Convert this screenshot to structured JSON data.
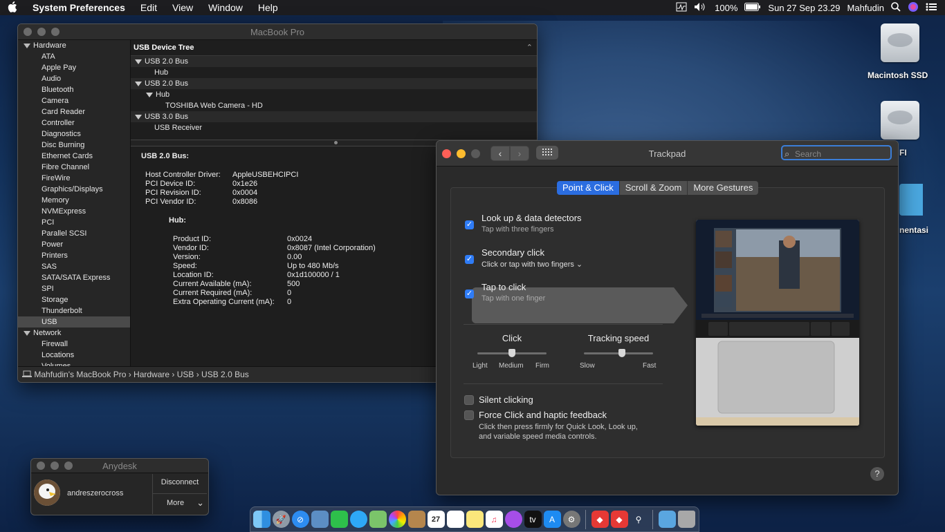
{
  "menubar": {
    "app_name": "System Preferences",
    "menus": [
      "Edit",
      "View",
      "Window",
      "Help"
    ],
    "battery": "100%",
    "datetime": "Sun 27 Sep  23.29",
    "user": "Mahfudin"
  },
  "desktop": {
    "icons": [
      "Macintosh SSD",
      "FI",
      "nentasi"
    ]
  },
  "sysinfo": {
    "title": "MacBook Pro",
    "sidebar": {
      "hardware_label": "Hardware",
      "hardware_items": [
        "ATA",
        "Apple Pay",
        "Audio",
        "Bluetooth",
        "Camera",
        "Card Reader",
        "Controller",
        "Diagnostics",
        "Disc Burning",
        "Ethernet Cards",
        "Fibre Channel",
        "FireWire",
        "Graphics/Displays",
        "Memory",
        "NVMExpress",
        "PCI",
        "Parallel SCSI",
        "Power",
        "Printers",
        "SAS",
        "SATA/SATA Express",
        "SPI",
        "Storage",
        "Thunderbolt",
        "USB"
      ],
      "selected": "USB",
      "network_label": "Network",
      "network_items": [
        "Firewall",
        "Locations",
        "Volumes"
      ]
    },
    "tree": {
      "header": "USB Device Tree",
      "rows": [
        {
          "label": "USB 2.0 Bus",
          "level": 0,
          "expanded": true
        },
        {
          "label": "Hub",
          "level": 1,
          "expanded": false
        },
        {
          "label": "USB 2.0 Bus",
          "level": 0,
          "expanded": true
        },
        {
          "label": "Hub",
          "level": 1,
          "expanded": true
        },
        {
          "label": "TOSHIBA Web Camera - HD",
          "level": 2,
          "expanded": false
        },
        {
          "label": "USB 3.0 Bus",
          "level": 0,
          "expanded": true
        },
        {
          "label": "USB Receiver",
          "level": 1,
          "expanded": false
        }
      ]
    },
    "detail": {
      "heading": "USB 2.0 Bus:",
      "props": [
        {
          "k": "Host Controller Driver:",
          "v": "AppleUSBEHCIPCI"
        },
        {
          "k": "PCI Device ID:",
          "v": "0x1e26"
        },
        {
          "k": "PCI Revision ID:",
          "v": "0x0004"
        },
        {
          "k": "PCI Vendor ID:",
          "v": "0x8086"
        }
      ],
      "sub_heading": "Hub:",
      "sub_props": [
        {
          "k": "Product ID:",
          "v": "0x0024"
        },
        {
          "k": "Vendor ID:",
          "v": "0x8087  (Intel Corporation)"
        },
        {
          "k": "Version:",
          "v": "0.00"
        },
        {
          "k": "Speed:",
          "v": "Up to 480 Mb/s"
        },
        {
          "k": "Location ID:",
          "v": "0x1d100000 / 1"
        },
        {
          "k": "Current Available (mA):",
          "v": "500"
        },
        {
          "k": "Current Required (mA):",
          "v": "0"
        },
        {
          "k": "Extra Operating Current (mA):",
          "v": "0"
        }
      ]
    },
    "path": "Mahfudin's MacBook Pro › Hardware › USB › USB 2.0 Bus"
  },
  "trackpad": {
    "title": "Trackpad",
    "search_placeholder": "Search",
    "tabs": [
      "Point & Click",
      "Scroll & Zoom",
      "More Gestures"
    ],
    "active_tab": "Point & Click",
    "options": [
      {
        "title": "Look up & data detectors",
        "sub": "Tap with three fingers",
        "checked": true
      },
      {
        "title": "Secondary click",
        "sub": "Click or tap with two fingers ⌄",
        "checked": true
      },
      {
        "title": "Tap to click",
        "sub": "Tap with one finger",
        "checked": true
      }
    ],
    "click": {
      "label": "Click",
      "ticks": [
        "Light",
        "Medium",
        "Firm"
      ],
      "value": "Medium"
    },
    "tracking": {
      "label": "Tracking speed",
      "ticks": [
        "Slow",
        "Fast"
      ],
      "value_fraction": 0.55
    },
    "silent_clicking": {
      "label": "Silent clicking",
      "checked": false
    },
    "force_click": {
      "label": "Force Click and haptic feedback",
      "desc1": "Click then press firmly for Quick Look, Look up,",
      "desc2": "and variable speed media controls.",
      "checked": false
    },
    "help": "?"
  },
  "anydesk": {
    "title": "Anydesk",
    "user": "andreszerocross",
    "disconnect": "Disconnect",
    "more": "More"
  },
  "dock": {
    "apps": [
      "finder",
      "launchpad",
      "safari",
      "preview",
      "facetime",
      "messages",
      "maps",
      "photos",
      "contacts",
      "calendar",
      "reminders",
      "notes",
      "music",
      "podcasts",
      "apple-tv",
      "app-store",
      "system-preferences",
      "anydesk",
      "anydesk-2",
      "automator",
      "folder",
      "trash"
    ],
    "calendar_day": "27"
  },
  "colors": {
    "accent": "#2f7cf6",
    "menubar": "#1d1d20"
  }
}
